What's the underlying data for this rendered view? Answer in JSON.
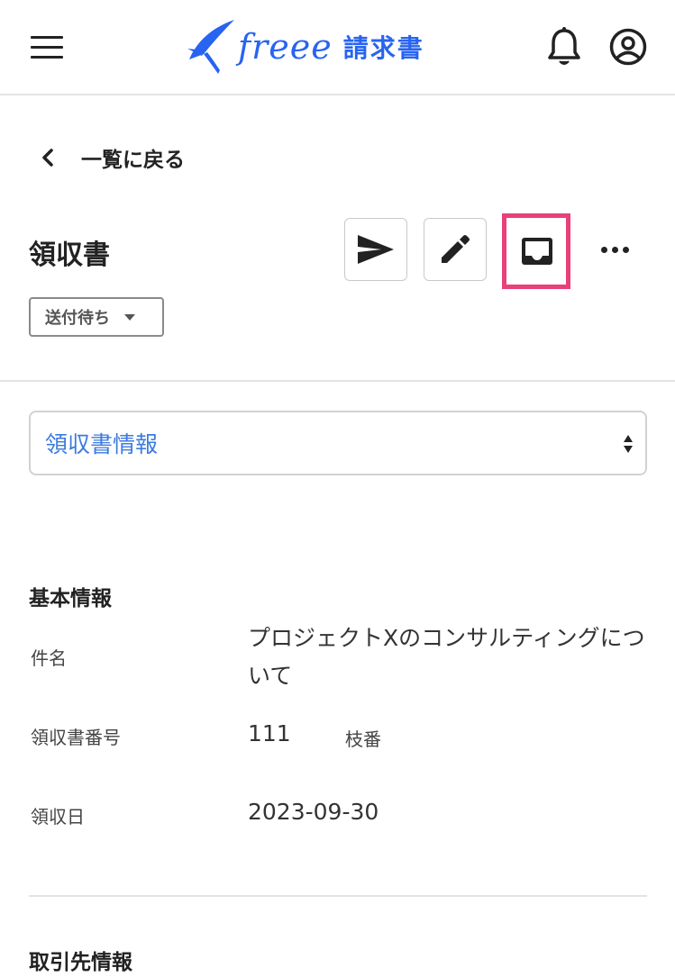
{
  "header": {
    "brand": "freee",
    "product": "請求書"
  },
  "nav": {
    "back_label": "一覧に戻る"
  },
  "doc": {
    "title": "領収書",
    "status": "送付待ち"
  },
  "section_select": {
    "value": "領収書情報"
  },
  "basic_info": {
    "heading": "基本情報",
    "subject_label": "件名",
    "subject_value": "プロジェクトXのコンサルティングについて",
    "number_label": "領収書番号",
    "number_value": "111",
    "branch_label": "枝番",
    "date_label": "領収日",
    "date_value": "2023-09-30"
  },
  "partner_info": {
    "heading": "取引先情報"
  },
  "colors": {
    "brand_blue": "#2864f0",
    "highlight": "#e8417a",
    "link_blue": "#3b7be0"
  }
}
